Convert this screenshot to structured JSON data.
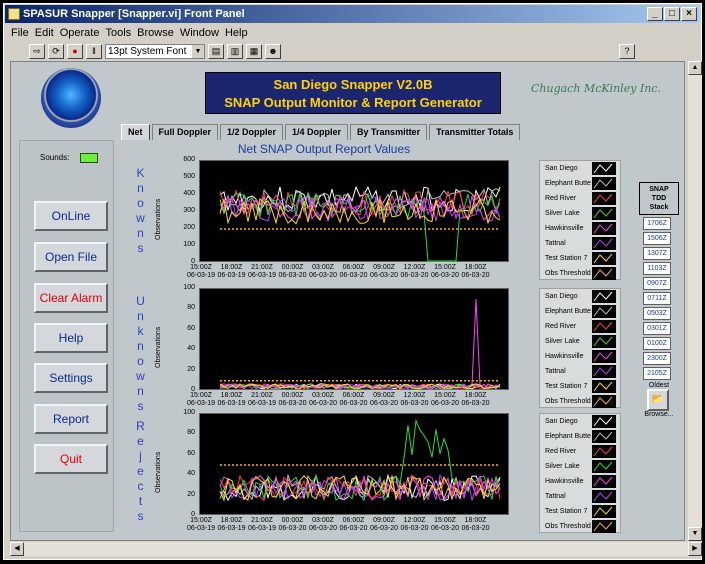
{
  "window": {
    "title": "SPASUR Snapper [Snapper.vi] Front Panel",
    "min": "_",
    "max": "□",
    "close": "×"
  },
  "menu": [
    "File",
    "Edit",
    "Operate",
    "Tools",
    "Browse",
    "Window",
    "Help"
  ],
  "toolbar": {
    "font": "13pt System Font",
    "help": "?"
  },
  "header": {
    "title_line1": "San Diego Snapper V2.0B",
    "title_line2": "SNAP Output Monitor & Report Generator",
    "brand": "Chugach McKinley Inc.",
    "logo_text": "AIR FORCE SPACE COMMAND"
  },
  "tabs": [
    "Net",
    "Full Doppler",
    "1/2 Doppler",
    "1/4 Doppler",
    "By Transmitter",
    "Transmitter Totals"
  ],
  "left": {
    "sounds_label": "Sounds:",
    "buttons": [
      "OnLine",
      "Open File",
      "Clear Alarm",
      "Help",
      "Settings",
      "Report",
      "Quit"
    ]
  },
  "main": {
    "heading": "Net SNAP Output Report Values",
    "ylabel": "Observations"
  },
  "charts": [
    {
      "vertical_label": "Knowns",
      "yticks": [
        "600",
        "500",
        "400",
        "300",
        "200",
        "100",
        "0"
      ],
      "ylim": [
        0,
        600
      ],
      "threshold": 200
    },
    {
      "vertical_label": "Unknowns",
      "yticks": [
        "100",
        "80",
        "60",
        "40",
        "20",
        "0"
      ],
      "ylim": [
        0,
        100
      ],
      "threshold": 10
    },
    {
      "vertical_label": "Rejects",
      "yticks": [
        "100",
        "80",
        "60",
        "40",
        "20",
        "0"
      ],
      "ylim": [
        0,
        100
      ],
      "threshold": 50
    }
  ],
  "xticks": [
    [
      "15:00Z",
      "06-03-19"
    ],
    [
      "18:00Z",
      "06-03-19"
    ],
    [
      "21:00Z",
      "06-03-19"
    ],
    [
      "00:00Z",
      "06-03-20"
    ],
    [
      "03:00Z",
      "06-03-20"
    ],
    [
      "06:00Z",
      "06-03-20"
    ],
    [
      "09:00Z",
      "06-03-20"
    ],
    [
      "12:00Z",
      "06-03-20"
    ],
    [
      "15:00Z",
      "06-03-20"
    ],
    [
      "18:00Z",
      "06-03-20"
    ]
  ],
  "legend": [
    {
      "name": "San Diego",
      "color": "#ffffff"
    },
    {
      "name": "Elephant Butte",
      "color": "#c0c0c0"
    },
    {
      "name": "Red River",
      "color": "#ff4040"
    },
    {
      "name": "Silver Lake",
      "color": "#20e040"
    },
    {
      "name": "Hawkinsville",
      "color": "#ff40ff"
    },
    {
      "name": "Tattnal",
      "color": "#c040ff"
    },
    {
      "name": "Test Station 7",
      "color": "#ffe000"
    },
    {
      "name": "Obs Threshold",
      "color": "#ffb000"
    }
  ],
  "stack": {
    "title": "SNAP TDD Stack",
    "items": [
      "1706Z",
      "1506Z",
      "1307Z",
      "1103Z",
      "0907Z",
      "0711Z",
      "0503Z",
      "0301Z",
      "0100Z",
      "2300Z",
      "2105Z"
    ],
    "oldest": "Oldest",
    "browse": "Browse..."
  }
}
